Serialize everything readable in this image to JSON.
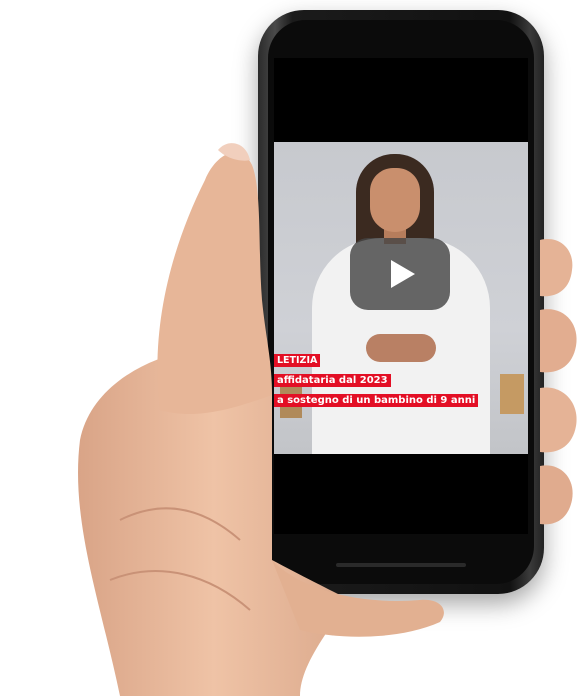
{
  "video": {
    "caption": {
      "name": "LETIZIA",
      "line1": "affidataria dal 2023",
      "line2": "a sostegno di un bambino di 9 anni"
    },
    "play_icon": "play-icon"
  },
  "colors": {
    "caption_bg": "#e30f25",
    "caption_text": "#ffffff",
    "play_button_bg": "#464646",
    "screen_bg": "#000000",
    "phone_body": "#1b1b1b",
    "skin": "#e9b89a"
  }
}
